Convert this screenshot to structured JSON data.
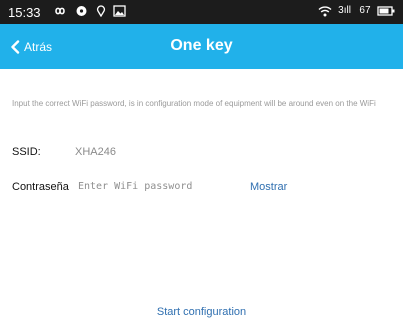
{
  "status_bar": {
    "time": "15:33",
    "signal_text": "3ıll",
    "battery": "67"
  },
  "header": {
    "back_label": "Atrás",
    "title": "One key"
  },
  "main": {
    "hint": "Input the correct WiFi password, is in configuration mode of equipment will be around even on the WiFi",
    "ssid_label": "SSID:",
    "ssid_value": "XHA246",
    "password_label": "Contraseña",
    "password_placeholder": "Enter WiFi password",
    "password_value": "",
    "show_label": "Mostrar",
    "start_label": "Start configuration"
  },
  "colors": {
    "app_bar": "#21b1ea",
    "status_bar": "#1c1c1c",
    "link": "#2f6fb0"
  },
  "icons": [
    "infinity-icon",
    "compass-icon",
    "location-pin-icon",
    "gallery-icon",
    "wifi-icon",
    "battery-icon",
    "back-chevron-icon"
  ]
}
